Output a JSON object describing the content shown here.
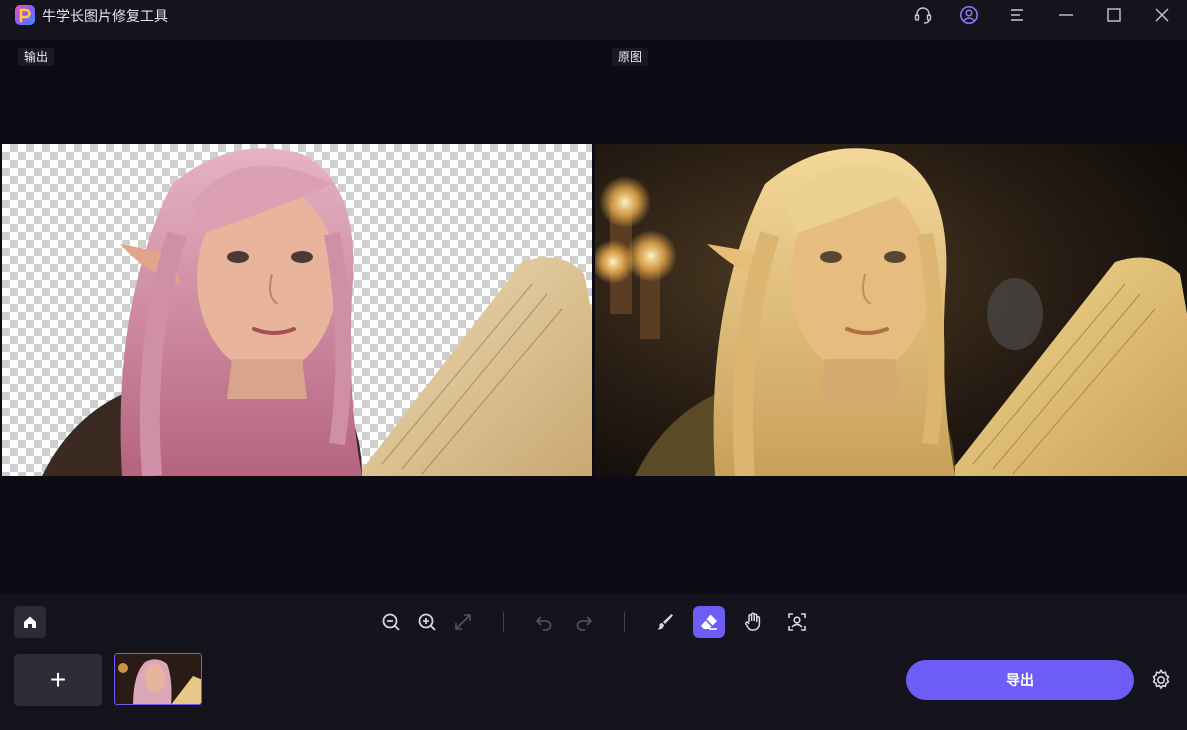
{
  "app": {
    "title": "牛学长图片修复工具"
  },
  "titlebar": {
    "buttons": [
      {
        "name": "support-icon"
      },
      {
        "name": "account-icon"
      },
      {
        "name": "menu-icon"
      },
      {
        "name": "minimize-icon"
      },
      {
        "name": "maximize-icon"
      },
      {
        "name": "close-icon"
      }
    ]
  },
  "panes": {
    "output_label": "输出",
    "original_label": "原图"
  },
  "toolbar": {
    "tools": [
      "zoom-out-icon",
      "zoom-in-icon",
      "fit-screen-icon",
      "undo-icon",
      "redo-icon",
      "brush-icon",
      "eraser-icon",
      "hand-pan-icon",
      "portrait-select-icon"
    ],
    "active_tool": "eraser-icon"
  },
  "footer": {
    "add_label": "+",
    "export_label": "导出"
  },
  "colors": {
    "accent": "#6e5cf6",
    "background": "#0d0b13",
    "panel": "#15131c"
  }
}
